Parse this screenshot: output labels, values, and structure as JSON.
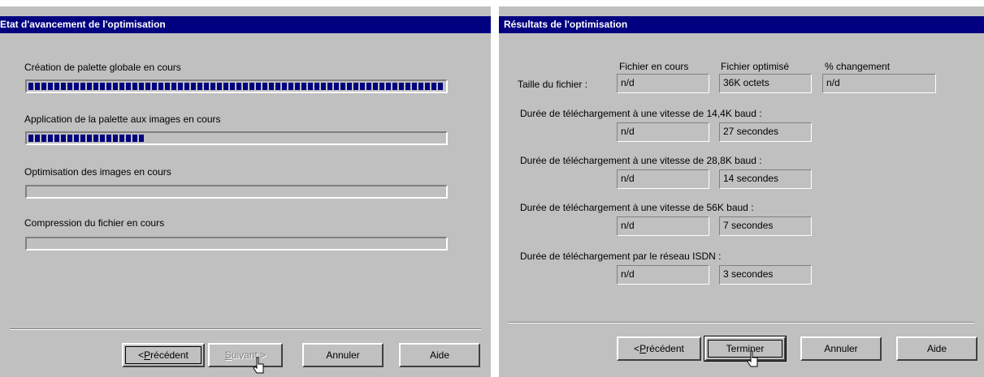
{
  "left": {
    "title": "Etat d'avancement de l'optimisation",
    "tasks": [
      {
        "label": "Création de palette globale en cours",
        "progress": 1.0
      },
      {
        "label": "Application de la palette aux images en cours",
        "progress": 0.28
      },
      {
        "label": "Optimisation des images en cours",
        "progress": 0.0
      },
      {
        "label": "Compression du fichier en cours",
        "progress": 0.0
      }
    ],
    "buttons": {
      "back": {
        "prefix": "< ",
        "accel": "P",
        "rest": "récédent"
      },
      "next": {
        "prefix": "",
        "accel": "S",
        "rest": "uivant >"
      },
      "cancel": "Annuler",
      "help": "Aide"
    }
  },
  "right": {
    "title": "Résultats de l'optimisation",
    "columns": {
      "current": "Fichier en cours",
      "optimized": "Fichier optimisé",
      "change": "% changement"
    },
    "file_size": {
      "label": "Taille du fichier :",
      "current": "n/d",
      "optimized": "36K octets",
      "change": "n/d"
    },
    "downloads": [
      {
        "label": "Durée de téléchargement à une vitesse de 14,4K baud :",
        "current": "n/d",
        "optimized": "27 secondes"
      },
      {
        "label": "Durée de téléchargement à une vitesse de 28,8K baud :",
        "current": "n/d",
        "optimized": "14 secondes"
      },
      {
        "label": "Durée de téléchargement à une vitesse de 56K baud :",
        "current": "n/d",
        "optimized": "7 secondes"
      },
      {
        "label": "Durée de téléchargement par le réseau ISDN :",
        "current": "n/d",
        "optimized": "3 secondes"
      }
    ],
    "buttons": {
      "back": {
        "prefix": "< ",
        "accel": "P",
        "rest": "récédent"
      },
      "finish": "Terminer",
      "cancel": "Annuler",
      "help": "Aide"
    }
  }
}
